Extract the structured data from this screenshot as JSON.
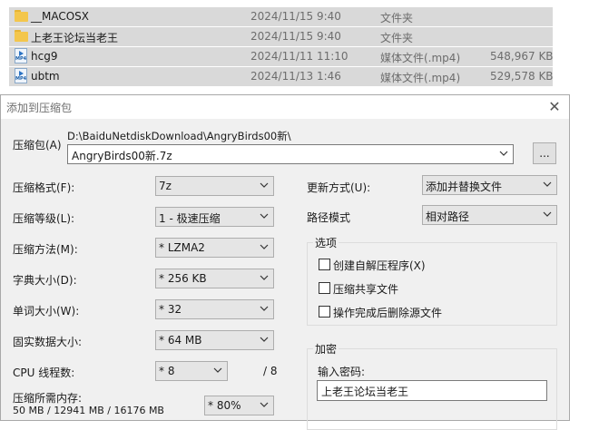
{
  "files": [
    {
      "name": "__MACOSX",
      "date": "2024/11/15 9:40",
      "type": "文件夹",
      "size": "",
      "icon": "folder-icon"
    },
    {
      "name": "上老王论坛当老王",
      "date": "2024/11/15 9:40",
      "type": "文件夹",
      "size": "",
      "icon": "folder-icon"
    },
    {
      "name": "hcg9",
      "date": "2024/11/11 11:10",
      "type": "媒体文件(.mp4)",
      "size": "548,967 KB",
      "icon": "mp4-file-icon"
    },
    {
      "name": "ubtm",
      "date": "2024/11/13 1:46",
      "type": "媒体文件(.mp4)",
      "size": "529,578 KB",
      "icon": "mp4-file-icon"
    }
  ],
  "mp4_badge": "MP4",
  "dialog": {
    "title": "添加到压缩包",
    "close_glyph": "✕",
    "archive_label": "压缩包(A)",
    "archive_path": "D:\\BaiduNetdiskDownload\\AngryBirds00新\\",
    "archive_name": "AngryBirds00新.7z",
    "browse_label": "...",
    "format_label": "压缩格式(F):",
    "format_value": "7z",
    "level_label": "压缩等级(L):",
    "level_value": "1 - 极速压缩",
    "method_label": "压缩方法(M):",
    "method_value": "* LZMA2",
    "dict_label": "字典大小(D):",
    "dict_value": "* 256 KB",
    "word_label": "单词大小(W):",
    "word_value": "* 32",
    "solid_label": "固实数据大小:",
    "solid_value": "* 64 MB",
    "cpu_label": "CPU 线程数:",
    "cpu_value": "* 8",
    "cpu_total": "/ 8",
    "mem_label": "压缩所需内存:",
    "mem_value": "50 MB / 12941 MB / 16176 MB",
    "mem_percent": "* 80%",
    "update_label": "更新方式(U):",
    "update_value": "添加并替换文件",
    "path_label": "路径模式",
    "path_value": "相对路径",
    "options_group": "选项",
    "opt_sfx": "创建自解压程序(X)",
    "opt_shared": "压缩共享文件",
    "opt_delete": "操作完成后删除源文件",
    "encrypt_group": "加密",
    "password_label": "输入密码:",
    "password_value": "上老王论坛当老王"
  }
}
